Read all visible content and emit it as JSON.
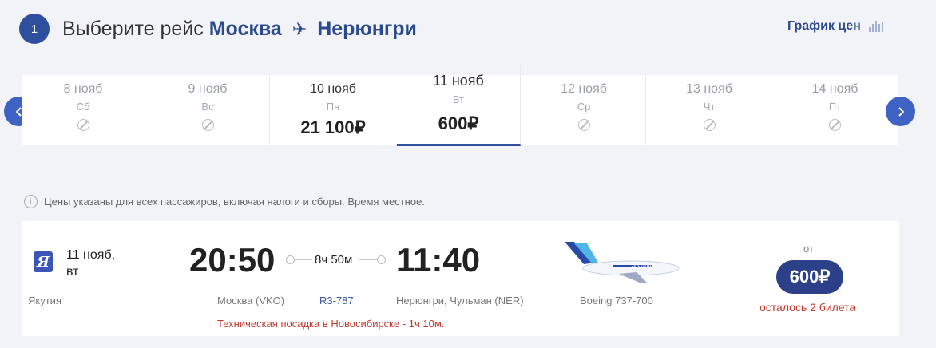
{
  "header": {
    "step_number": "1",
    "title_prefix": "Выберите рейс",
    "origin": "Москва",
    "destination": "Нерюнгри",
    "price_chart_label": "График цен"
  },
  "dates": [
    {
      "date": "8 нояб",
      "weekday": "Сб",
      "price": null
    },
    {
      "date": "9 нояб",
      "weekday": "Вс",
      "price": null
    },
    {
      "date": "10 нояб",
      "weekday": "Пн",
      "price": "21 100₽"
    },
    {
      "date": "11 нояб",
      "weekday": "Вт",
      "price": "600₽",
      "selected": true
    },
    {
      "date": "12 нояб",
      "weekday": "Ср",
      "price": null
    },
    {
      "date": "13 нояб",
      "weekday": "Чт",
      "price": null
    },
    {
      "date": "14 нояб",
      "weekday": "Пт",
      "price": null
    }
  ],
  "notice": "Цены указаны для всех пассажиров, включая налоги и сборы. Время местное.",
  "flight": {
    "date_line1": "11 нояб,",
    "date_line2": "вт",
    "airline": "Якутия",
    "airline_logo_letter": "Я",
    "departure_time": "20:50",
    "arrival_time": "11:40",
    "duration": "8ч 50м",
    "departure_airport": "Москва (VKO)",
    "flight_number": "R3-787",
    "arrival_airport": "Нерюнгри, Чульман (NER)",
    "aircraft": "Boeing 737-700",
    "stopover": "Техническая посадка в Новосибирске - 1ч 10м.",
    "price_from": "от",
    "price": "600₽",
    "seats_left": "осталось 2 билета"
  },
  "colors": {
    "accent": "#2d4f9e",
    "nav_button": "#3f63c4",
    "price_pill": "#2b4088",
    "warning": "#c0392b"
  }
}
